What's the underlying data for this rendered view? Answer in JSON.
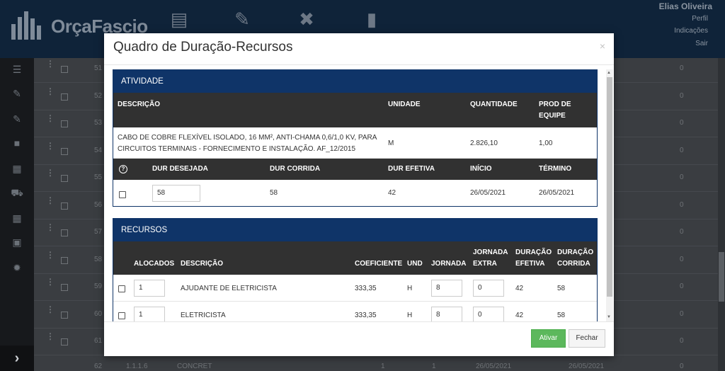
{
  "app": {
    "logo_text": "OrçaFascio",
    "user_name": "Elias Oliveira",
    "user_links": [
      "Perfil",
      "Indicações",
      "Sair"
    ],
    "bg_rows": [
      {
        "num": "51",
        "zero": "0"
      },
      {
        "num": "52",
        "zero": "0"
      },
      {
        "num": "53",
        "zero": "0"
      },
      {
        "num": "54",
        "zero": "0"
      },
      {
        "num": "55",
        "zero": "0"
      },
      {
        "num": "56",
        "zero": "0"
      },
      {
        "num": "57",
        "zero": "0"
      },
      {
        "num": "58",
        "zero": "0"
      },
      {
        "num": "59",
        "zero": "0"
      },
      {
        "num": "60",
        "zero": "0"
      },
      {
        "num": "61",
        "zero": "0"
      }
    ],
    "bottom_row": {
      "num": "62",
      "code": "1.1.1.6",
      "desc": "CONCRET",
      "a": "1",
      "b": "1",
      "date1": "26/05/2021",
      "date2": "26/05/2021",
      "zero": "0"
    }
  },
  "modal": {
    "title": "Quadro de Duração-Recursos",
    "close": "×",
    "atividade": {
      "heading": "ATIVIDADE",
      "headers": {
        "descricao": "DESCRIÇÃO",
        "unidade": "UNIDADE",
        "quantidade": "QUANTIDADE",
        "prod_line1": "PROD DE",
        "prod_line2": "EQUIPE"
      },
      "row": {
        "descricao_line1": "CABO DE COBRE FLEXÍVEL ISOLADO, 16 MM², ANTI-CHAMA 0,6/1,0 KV, PARA",
        "descricao_line2": "CIRCUITOS TERMINAIS - FORNECIMENTO E INSTALAÇÃO. AF_12/2015",
        "unidade": "M",
        "quantidade": "2.826,10",
        "prod": "1,00"
      },
      "dur_headers": {
        "help": "?",
        "dur_desejada": "DUR DESEJADA",
        "dur_corrida": "DUR CORRIDA",
        "dur_efetiva": "DUR EFETIVA",
        "inicio": "INÍCIO",
        "termino": "TÉRMINO"
      },
      "dur_row": {
        "dur_desejada": "58",
        "dur_corrida": "58",
        "dur_efetiva": "42",
        "inicio": "26/05/2021",
        "termino": "26/05/2021"
      }
    },
    "recursos": {
      "heading": "RECURSOS",
      "headers": {
        "alocados": "ALOCADOS",
        "descricao": "DESCRIÇÃO",
        "coeficiente": "COEFICIENTE",
        "und": "UND",
        "jornada": "JORNADA",
        "jornada_extra_line1": "JORNADA",
        "jornada_extra_line2": "EXTRA",
        "duracao_efetiva_line1": "DURAÇÃO",
        "duracao_efetiva_line2": "EFETIVA",
        "duracao_corrida_line1": "DURAÇÃO",
        "duracao_corrida_line2": "CORRIDA"
      },
      "rows": [
        {
          "alocados": "1",
          "descricao": "AJUDANTE DE ELETRICISTA",
          "coeficiente": "333,35",
          "und": "H",
          "jornada": "8",
          "jornada_extra": "0",
          "duracao_efetiva": "42",
          "duracao_corrida": "58"
        },
        {
          "alocados": "1",
          "descricao": "ELETRICISTA",
          "coeficiente": "333,35",
          "und": "H",
          "jornada": "8",
          "jornada_extra": "0",
          "duracao_efetiva": "42",
          "duracao_corrida": "58"
        }
      ]
    },
    "buttons": {
      "ativar": "Ativar",
      "fechar": "Fechar"
    }
  }
}
